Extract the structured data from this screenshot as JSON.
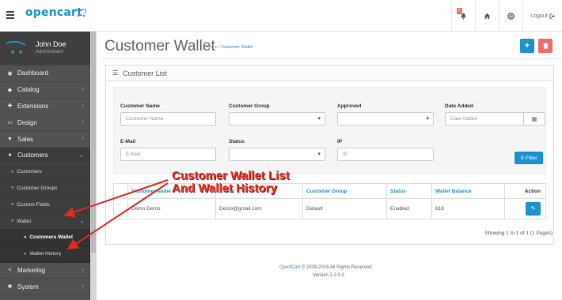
{
  "header": {
    "logo_text": "opencart",
    "notification_count": "5",
    "logout_label": "Logout"
  },
  "profile": {
    "name": "John Doe",
    "role": "Administrator"
  },
  "sidebar": {
    "items": [
      {
        "label": "Dashboard",
        "icon": "dashboard-icon"
      },
      {
        "label": "Catalog",
        "icon": "tag-icon"
      },
      {
        "label": "Extensions",
        "icon": "puzzle-icon"
      },
      {
        "label": "Design",
        "icon": "monitor-icon"
      },
      {
        "label": "Sales",
        "icon": "cart-icon"
      },
      {
        "label": "Customers",
        "icon": "user-icon"
      }
    ],
    "customers_sub": [
      "Customers",
      "Customer Groups",
      "Custom Fields",
      "Wallet"
    ],
    "wallet_sub": [
      "Customers Wallet",
      "Wallet History"
    ],
    "bottom_items": [
      {
        "label": "Marketing",
        "icon": "share-icon"
      },
      {
        "label": "System",
        "icon": "cog-icon"
      }
    ]
  },
  "page": {
    "title": "Customer Wallet",
    "breadcrumb_home": "Home",
    "breadcrumb_sep": "/",
    "breadcrumb_current": "Customer Wallet"
  },
  "panel": {
    "title": "Customer List"
  },
  "filter": {
    "customer_name_label": "Customer Name",
    "customer_name_placeholder": "Customer Name",
    "customer_group_label": "Customer Group",
    "approved_label": "Approved",
    "date_added_label": "Date Added",
    "date_added_placeholder": "Date Added",
    "email_label": "E-Mail",
    "email_placeholder": "E-Mail",
    "status_label": "Status",
    "ip_label": "IP",
    "ip_placeholder": "IP",
    "filter_button": "Filter"
  },
  "table": {
    "headers": [
      "Customer Name ▾",
      "E-Mail",
      "Customer Group",
      "Status",
      "Wallet Balance",
      "Action"
    ],
    "rows": [
      {
        "name": "Demo Demo",
        "email": "Demo@gmail.com",
        "group": "Default",
        "status": "Enabled",
        "balance": "618"
      }
    ],
    "pager": "Showing 1 to 1 of 1 (1 Pages)"
  },
  "footer": {
    "brand": "OpenCart",
    "copyright": "© 2009-2016 All Rights Reserved.",
    "version": "Version 2.2.0.0"
  },
  "annotation": {
    "line1": "Customer Wallet List",
    "line2": "And Wallet History",
    "color": "#e63a2e"
  },
  "colors": {
    "accent": "#1e91cf",
    "danger": "#f56b6b",
    "sidebar": "#515151"
  }
}
